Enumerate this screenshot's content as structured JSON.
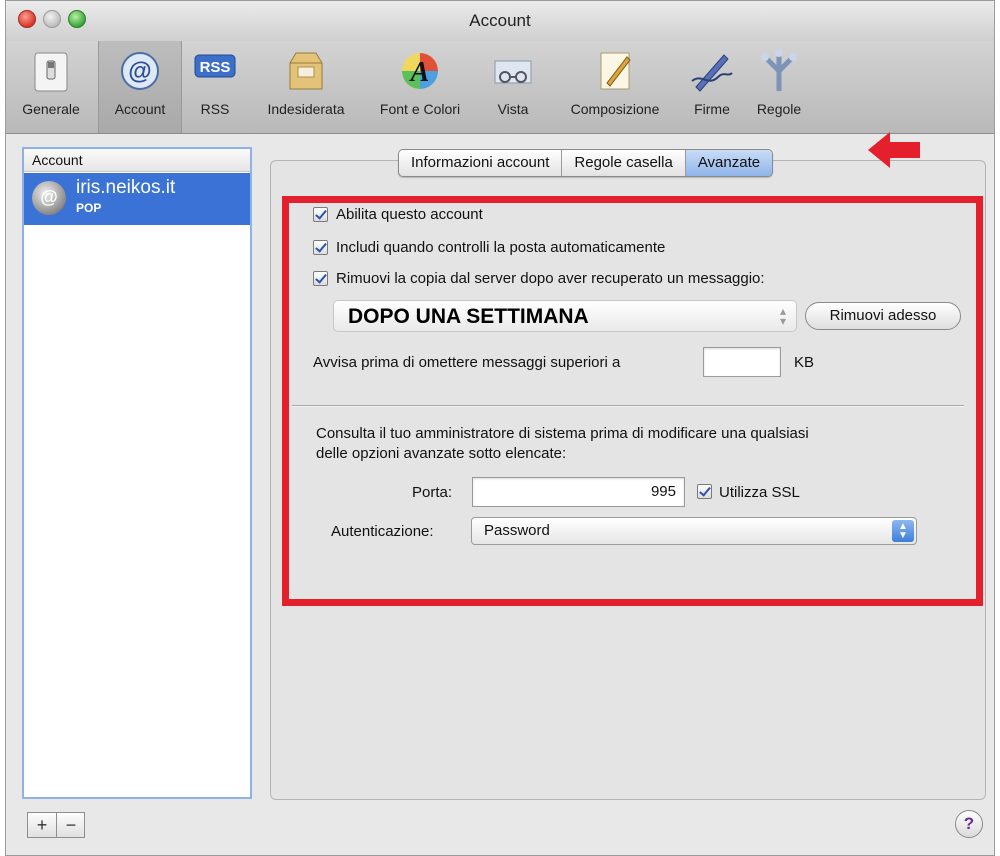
{
  "window": {
    "title": "Account"
  },
  "toolbar": {
    "items": [
      {
        "label": "Generale",
        "icon": "switch-icon"
      },
      {
        "label": "Account",
        "icon": "at-icon"
      },
      {
        "label": "RSS",
        "icon": "rss-icon",
        "icon_text": "RSS"
      },
      {
        "label": "Indesiderata",
        "icon": "junk-mail-icon"
      },
      {
        "label": "Font e Colori",
        "icon": "font-colors-icon",
        "icon_text": "A"
      },
      {
        "label": "Vista",
        "icon": "view-glasses-icon"
      },
      {
        "label": "Composizione",
        "icon": "compose-pencil-icon"
      },
      {
        "label": "Firme",
        "icon": "signature-pen-icon"
      },
      {
        "label": "Regole",
        "icon": "rules-icon"
      }
    ],
    "selected": "Account"
  },
  "sidebar": {
    "header": "Account",
    "accounts": [
      {
        "name": "iris.neikos.it",
        "type": "POP",
        "icon_text": "@"
      }
    ],
    "add_label": "+",
    "remove_label": "−"
  },
  "tabs": [
    {
      "label": "Informazioni account",
      "active": false
    },
    {
      "label": "Regole casella",
      "active": false
    },
    {
      "label": "Avanzate",
      "active": true
    }
  ],
  "advanced": {
    "enable_account": {
      "label": "Abilita questo account",
      "checked": true
    },
    "include_auto_check": {
      "label": "Includi quando controlli la posta automaticamente",
      "checked": true
    },
    "remove_copy": {
      "label": "Rimuovi la copia dal server dopo aver recuperato un messaggio:",
      "checked": true
    },
    "remove_after_value": "DOPO UNA SETTIMANA",
    "remove_now_label": "Rimuovi adesso",
    "warn_label": "Avvisa prima di omettere messaggi superiori a",
    "warn_value": "",
    "warn_unit": "KB",
    "admin_note_line1": "Consulta il tuo amministratore di sistema prima di modificare una qualsiasi",
    "admin_note_line2": "delle opzioni avanzate sotto elencate:",
    "port_label": "Porta:",
    "port_value": "995",
    "use_ssl": {
      "label": "Utilizza SSL",
      "checked": true
    },
    "auth_label": "Autenticazione:",
    "auth_value": "Password"
  },
  "help_label": "?",
  "colors": {
    "highlight": "#e4202c",
    "selection": "#3a72d6",
    "check": "#2a54b0"
  }
}
